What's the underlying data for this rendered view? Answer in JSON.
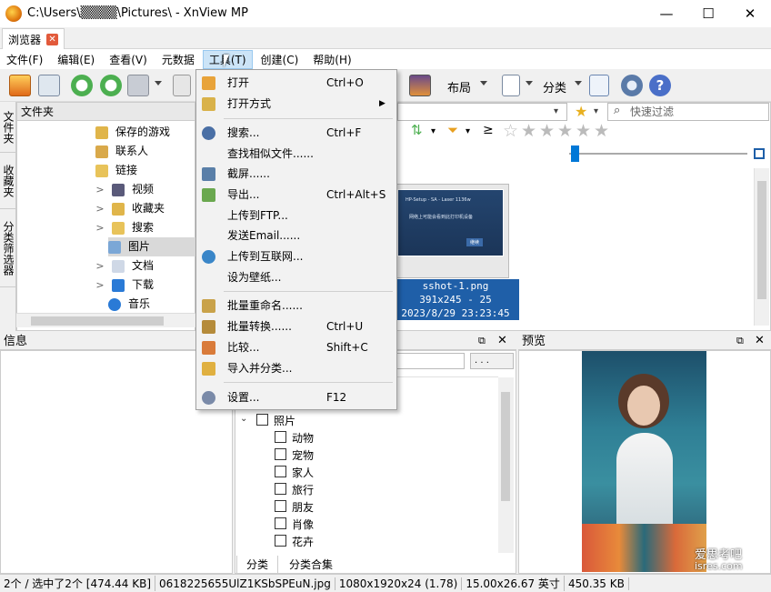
{
  "window": {
    "title": "C:\\Users\\▒▒▒▒\\Pictures\\ - XnView MP",
    "minimize": "—",
    "maximize": "☐",
    "close": "✕"
  },
  "tab": {
    "label": "浏览器",
    "close": "✕"
  },
  "menubar": [
    "文件(F)",
    "编辑(E)",
    "查看(V)",
    "元数据",
    "工具(T)",
    "创建(C)",
    "帮助(H)"
  ],
  "toolbar": {
    "layout_label": "布局",
    "category_label": "分类"
  },
  "side_tabs": [
    "文件夹",
    "收藏夹",
    "分类筛选器"
  ],
  "folder_pane": {
    "header": "文件夹",
    "items": [
      {
        "label": "保存的游戏",
        "chevron": ""
      },
      {
        "label": "联系人",
        "chevron": ""
      },
      {
        "label": "链接",
        "chevron": ""
      },
      {
        "label": "视频",
        "chevron": ">"
      },
      {
        "label": "收藏夹",
        "chevron": ">"
      },
      {
        "label": "搜索",
        "chevron": ">"
      },
      {
        "label": "图片",
        "chevron": ""
      },
      {
        "label": "文档",
        "chevron": ">"
      },
      {
        "label": "下载",
        "chevron": ">"
      },
      {
        "label": "音乐",
        "chevron": ""
      }
    ]
  },
  "filter": {
    "placeholder": "快速过滤",
    "rating_op": "≥"
  },
  "thumbnail": {
    "name": "sshot-1.png",
    "dims": "391x245 - 25",
    "date": "2023/8/29 23:23:45",
    "inner_title": "HP-Setup - SA - Laser 1136w",
    "inner_text": "网络上可能会看到此打印机设备",
    "inner_btn": "继续"
  },
  "info_pane": {
    "title": "信息"
  },
  "category_pane": {
    "dropdown": ". . .",
    "group": "照片",
    "items": [
      "动物",
      "宠物",
      "家人",
      "旅行",
      "朋友",
      "肖像",
      "花卉"
    ],
    "tabs": [
      "分类",
      "分类合集"
    ]
  },
  "preview_pane": {
    "title": "预览",
    "watermark1": "爱思考吧",
    "watermark2": "isres.com"
  },
  "tools_menu": [
    {
      "label": "打开",
      "shortcut": "Ctrl+O",
      "icon": "open-icon",
      "color": "#e8a33a"
    },
    {
      "label": "打开方式",
      "shortcut": "",
      "icon": "open-with-icon",
      "color": "#d9b24a",
      "submenu": true
    },
    {
      "sep": true
    },
    {
      "label": "搜索...",
      "shortcut": "Ctrl+F",
      "icon": "binoculars-icon",
      "color": "#4a6fa5"
    },
    {
      "label": "查找相似文件......",
      "shortcut": "",
      "icon": "",
      "color": ""
    },
    {
      "label": "截屏......",
      "shortcut": "",
      "icon": "camera-icon",
      "color": "#5a7fa8"
    },
    {
      "label": "导出...",
      "shortcut": "Ctrl+Alt+S",
      "icon": "export-icon",
      "color": "#6aa84f"
    },
    {
      "label": "上传到FTP...",
      "shortcut": "",
      "icon": "",
      "color": ""
    },
    {
      "label": "发送Email......",
      "shortcut": "",
      "icon": "",
      "color": ""
    },
    {
      "label": "上传到互联网...",
      "shortcut": "",
      "icon": "globe-icon",
      "color": "#3a86c8"
    },
    {
      "label": "设为壁纸...",
      "shortcut": "",
      "icon": "",
      "color": ""
    },
    {
      "sep": true
    },
    {
      "label": "批量重命名......",
      "shortcut": "",
      "icon": "rename-icon",
      "color": "#c9a24a"
    },
    {
      "label": "批量转换......",
      "shortcut": "Ctrl+U",
      "icon": "convert-icon",
      "color": "#b58b3a"
    },
    {
      "label": "比较...",
      "shortcut": "Shift+C",
      "icon": "compare-icon",
      "color": "#d97b3a"
    },
    {
      "label": "导入并分类...",
      "shortcut": "",
      "icon": "import-icon",
      "color": "#e0b040"
    },
    {
      "sep": true
    },
    {
      "label": "设置...",
      "shortcut": "F12",
      "icon": "gear-icon",
      "color": "#7a8aa8"
    }
  ],
  "status": [
    "2个 / 选中了2个 [474.44 KB]",
    "0618225655UlZ1KSbSPEuN.jpg",
    "1080x1920x24 (1.78)",
    "15.00x26.67 英寸",
    "450.35 KB"
  ]
}
